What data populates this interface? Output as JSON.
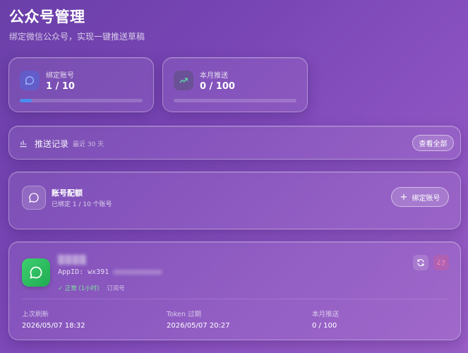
{
  "header": {
    "title": "公众号管理",
    "subtitle": "绑定微信公众号，实现一键推送草稿"
  },
  "stats": [
    {
      "label": "绑定账号",
      "value": "1 / 10",
      "progress": 0.1,
      "icon": "chat-bubble-icon"
    },
    {
      "label": "本月推送",
      "value": "0 / 100",
      "progress": 0,
      "icon": "trending-up-icon"
    }
  ],
  "records": {
    "title": "推送记录",
    "subtitle": "最近 30 天",
    "view_all_label": "查看全部"
  },
  "quota": {
    "title": "账号配额",
    "subtitle": "已绑定 1 / 10 个账号",
    "bind_label": "绑定账号"
  },
  "account": {
    "name": "▒▒▒▒",
    "appid_prefix": "AppID: wx391",
    "status": "✓ 正常 (1小时)",
    "type": "订阅号",
    "meta": [
      {
        "label": "上次刷新",
        "value": "2026/05/07 18:32"
      },
      {
        "label": "Token 过期",
        "value": "2026/05/07 20:27"
      },
      {
        "label": "本月推送",
        "value": "0 / 100"
      }
    ]
  },
  "colors": {
    "accent_blue": "#4a8cf0",
    "status_green": "#7fe0a0",
    "wechat_green": "#2fbf5e"
  }
}
